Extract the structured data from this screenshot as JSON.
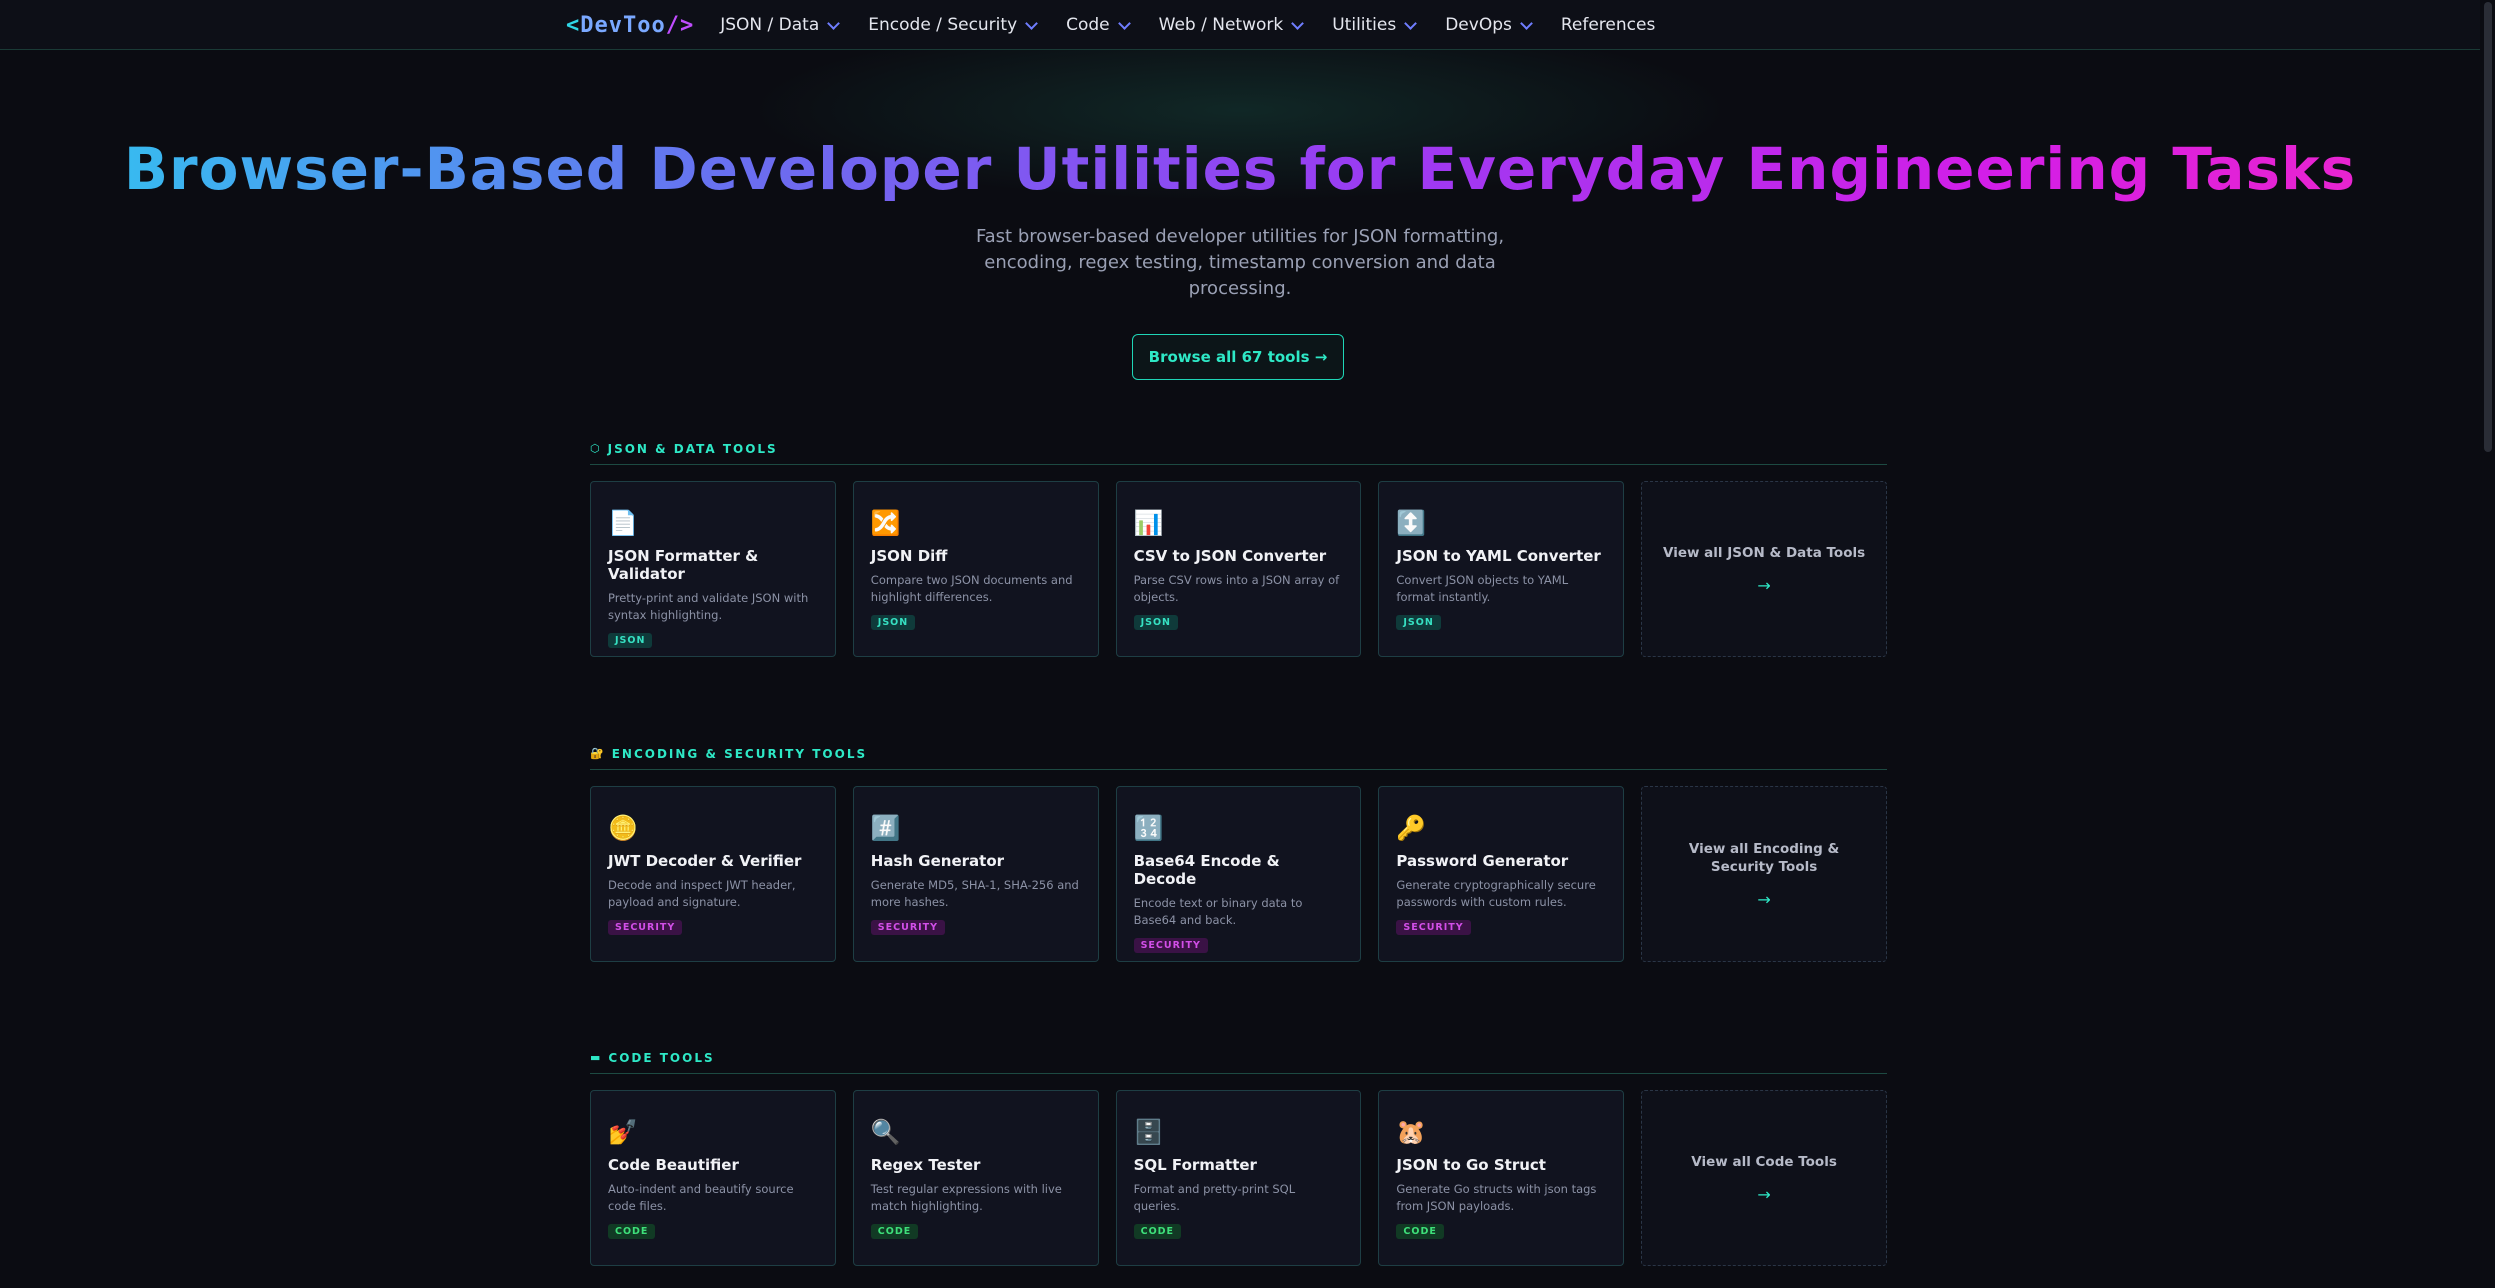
{
  "nav": {
    "logo_open": "<",
    "logo_text": "DevToo",
    "logo_close": " />",
    "items": [
      {
        "label": "JSON / Data",
        "dropdown": true
      },
      {
        "label": "Encode / Security",
        "dropdown": true
      },
      {
        "label": "Code",
        "dropdown": true
      },
      {
        "label": "Web / Network",
        "dropdown": true
      },
      {
        "label": "Utilities",
        "dropdown": true
      },
      {
        "label": "DevOps",
        "dropdown": true
      },
      {
        "label": "References",
        "dropdown": false
      }
    ]
  },
  "hero": {
    "title": "Browser-Based Developer Utilities for Everyday Engineering Tasks",
    "subtitle": "Fast browser-based developer utilities for JSON formatting, encoding, regex testing, timestamp conversion and data processing.",
    "browse_button": "Browse all 67 tools →"
  },
  "sections": [
    {
      "icon": "⬡",
      "heading": "JSON & DATA TOOLS",
      "cards": [
        {
          "icon": "📄",
          "title": "JSON Formatter & Validator",
          "desc": "Pretty-print and validate JSON with syntax highlighting.",
          "tag": "JSON"
        },
        {
          "icon": "🔀",
          "title": "JSON Diff",
          "desc": "Compare two JSON documents and highlight differences.",
          "tag": "JSON"
        },
        {
          "icon": "📊",
          "title": "CSV to JSON Converter",
          "desc": "Parse CSV rows into a JSON array of objects.",
          "tag": "JSON"
        },
        {
          "icon": "↕️",
          "title": "JSON to YAML Converter",
          "desc": "Convert JSON objects to YAML format instantly.",
          "tag": "JSON"
        }
      ],
      "view_all": "View all JSON & Data Tools",
      "view_all_arrow": "→"
    },
    {
      "icon": "🔐",
      "heading": "ENCODING & SECURITY TOOLS",
      "cards": [
        {
          "icon": "🪙",
          "title": "JWT Decoder & Verifier",
          "desc": "Decode and inspect JWT header, payload and signature.",
          "tag": "SECURITY"
        },
        {
          "icon": "#️⃣",
          "title": "Hash Generator",
          "desc": "Generate MD5, SHA-1, SHA-256 and more hashes.",
          "tag": "SECURITY"
        },
        {
          "icon": "🔢",
          "title": "Base64 Encode & Decode",
          "desc": "Encode text or binary data to Base64 and back.",
          "tag": "SECURITY"
        },
        {
          "icon": "🔑",
          "title": "Password Generator",
          "desc": "Generate cryptographically secure passwords with custom rules.",
          "tag": "SECURITY"
        }
      ],
      "view_all": "View all Encoding & Security Tools",
      "view_all_arrow": "→"
    },
    {
      "icon": "▬",
      "heading": "CODE TOOLS",
      "cards": [
        {
          "icon": "💅",
          "title": "Code Beautifier",
          "desc": "Auto-indent and beautify source code files.",
          "tag": "CODE"
        },
        {
          "icon": "🔍",
          "title": "Regex Tester",
          "desc": "Test regular expressions with live match highlighting.",
          "tag": "CODE"
        },
        {
          "icon": "🗄️",
          "title": "SQL Formatter",
          "desc": "Format and pretty-print SQL queries.",
          "tag": "CODE"
        },
        {
          "icon": "🐹",
          "title": "JSON to Go Struct",
          "desc": "Generate Go structs with json tags from JSON payloads.",
          "tag": "CODE"
        }
      ],
      "view_all": "View all Code Tools",
      "view_all_arrow": "→"
    }
  ]
}
